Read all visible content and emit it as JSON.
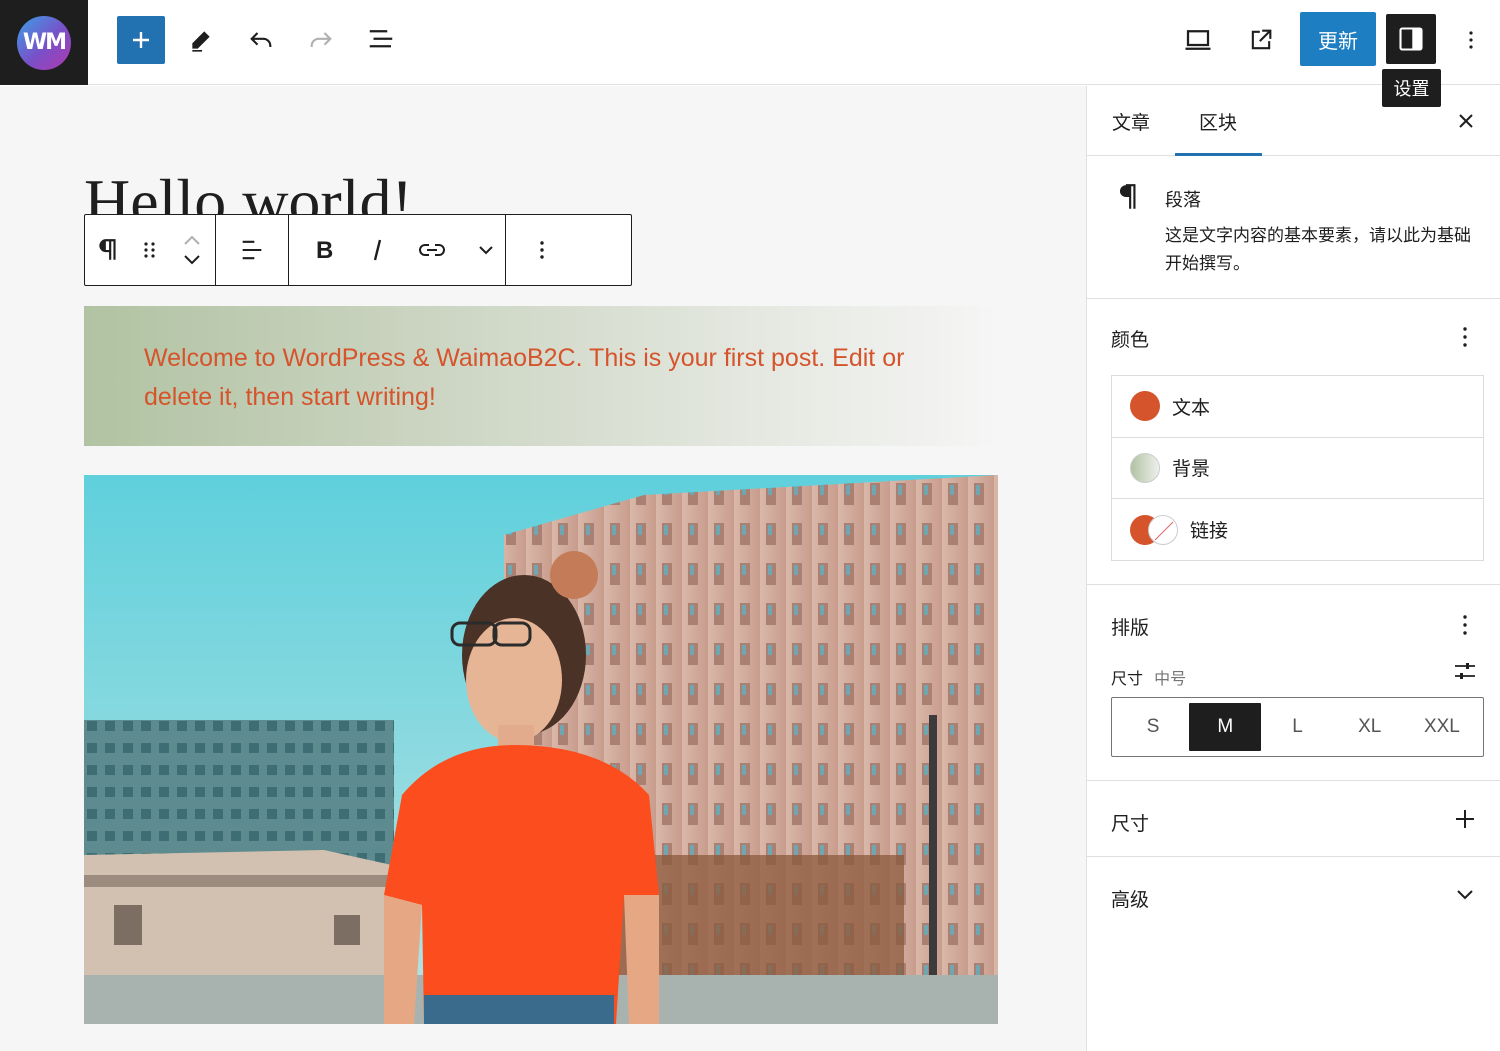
{
  "toolbar": {
    "logo_text": "WM",
    "update_label": "更新",
    "settings_tooltip": "设置"
  },
  "post": {
    "title": "Hello world!",
    "paragraph": "Welcome to WordPress & WaimaoB2C. This is your first post. Edit or delete it, then start writing!"
  },
  "sidebar": {
    "tabs": [
      {
        "label": "文章"
      },
      {
        "label": "区块"
      }
    ],
    "active_tab": "区块",
    "block": {
      "name": "段落",
      "description": "这是文字内容的基本要素，请以此为基础开始撰写。"
    },
    "color": {
      "title": "颜色",
      "items": [
        {
          "label": "文本"
        },
        {
          "label": "背景"
        },
        {
          "label": "链接"
        }
      ]
    },
    "typography": {
      "title": "排版",
      "size_label": "尺寸",
      "size_value": "中号",
      "sizes": [
        "S",
        "M",
        "L",
        "XL",
        "XXL"
      ],
      "selected_size": "M"
    },
    "dimensions": {
      "title": "尺寸"
    },
    "advanced": {
      "title": "高级"
    }
  },
  "colors": {
    "accent": "#2271b1",
    "text_color": "#d5542c",
    "background_color": "#b1c3a2",
    "dark": "#1e1e1e"
  }
}
